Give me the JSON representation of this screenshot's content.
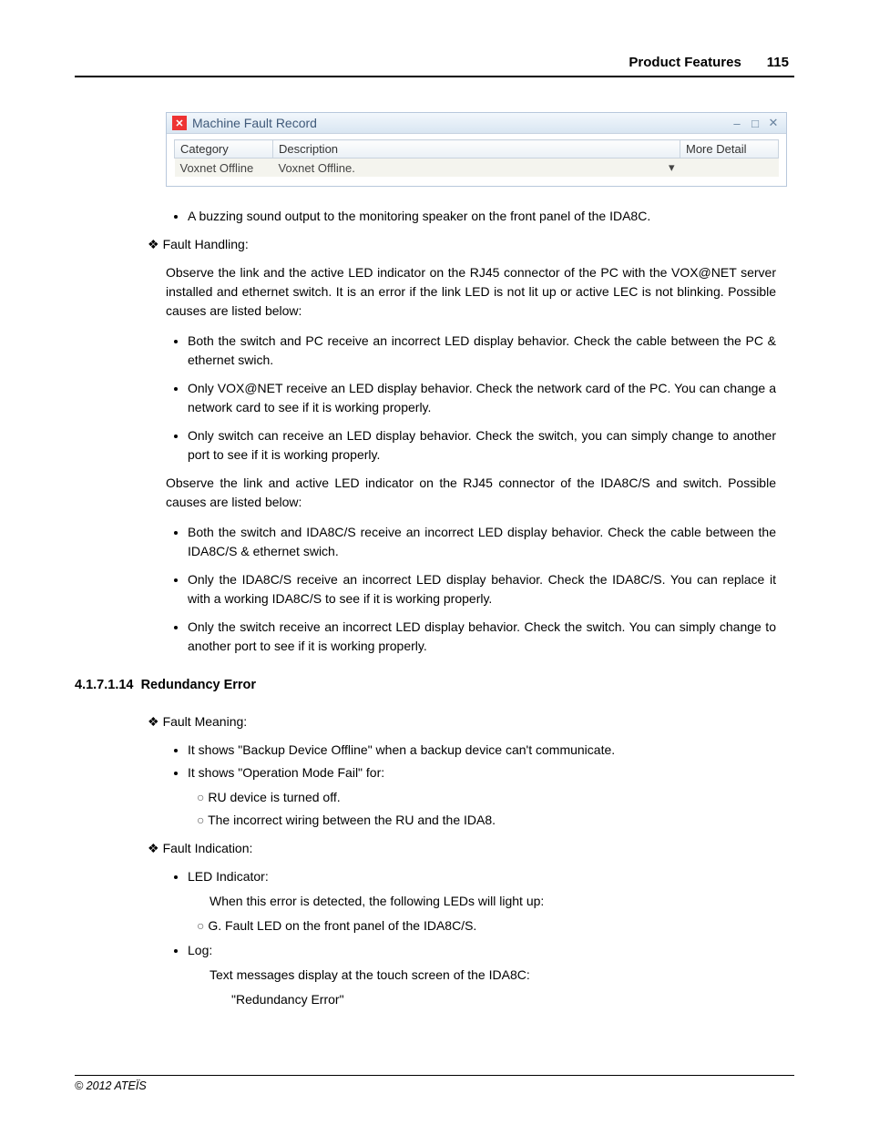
{
  "header": {
    "title": "Product Features",
    "page_number": "115"
  },
  "app_window": {
    "title": "Machine Fault Record",
    "columns": {
      "category": "Category",
      "description": "Description",
      "more_detail": "More Detail"
    },
    "row": {
      "category": "Voxnet Offline",
      "description": "Voxnet Offline."
    }
  },
  "body": {
    "bullet_buzzing": "A buzzing sound output to the monitoring speaker on the front panel of the IDA8C.",
    "fault_handling_label": "Fault Handling:",
    "observe_pc": "Observe the link and the active LED indicator on the RJ45 connector of the PC with the VOX@NET server installed and ethernet switch. It is an error if the link LED is not lit up or active LEC is not blinking. Possible causes are listed below:",
    "pc_causes": [
      "Both the switch and PC receive an incorrect LED display behavior. Check the cable between the PC & ethernet swich.",
      "Only VOX@NET receive an LED display behavior. Check the network card of the PC. You can change a network card to see if it is working properly.",
      "Only switch can receive an LED display behavior. Check the switch, you can simply change to another port to see if it is working properly."
    ],
    "observe_ida": "Observe the link and active LED indicator on the RJ45 connector of the IDA8C/S and switch. Possible causes are listed below:",
    "ida_causes": [
      "Both the switch and IDA8C/S receive an incorrect LED display behavior. Check the cable between the IDA8C/S & ethernet swich.",
      "Only the IDA8C/S receive an incorrect LED display behavior. Check the IDA8C/S. You can replace it with a working IDA8C/S to see if it is working properly.",
      "Only the switch receive an incorrect LED display behavior. Check the switch. You can simply change to another port to see if it is working properly."
    ]
  },
  "section": {
    "number": "4.1.7.1.14",
    "title": "Redundancy Error"
  },
  "body2": {
    "fault_meaning_label": "Fault Meaning:",
    "meaning_bullets": [
      "It shows \"Backup Device Offline\" when a backup device can't communicate.",
      "It shows \"Operation Mode Fail\" for:"
    ],
    "mode_fail_sub": [
      "RU device is turned off.",
      "The incorrect wiring between the RU and the IDA8."
    ],
    "fault_indication_label": "Fault Indication:",
    "led_indicator_label": "LED Indicator:",
    "led_when": "When this error is detected, the following LEDs will light up:",
    "led_sub": "G. Fault LED on the front panel of the IDA8C/S.",
    "log_label": "Log:",
    "log_text": "Text messages display at the touch screen of the IDA8C:",
    "log_quote": "\"Redundancy Error\""
  },
  "footer": "© 2012 ATEÏS"
}
